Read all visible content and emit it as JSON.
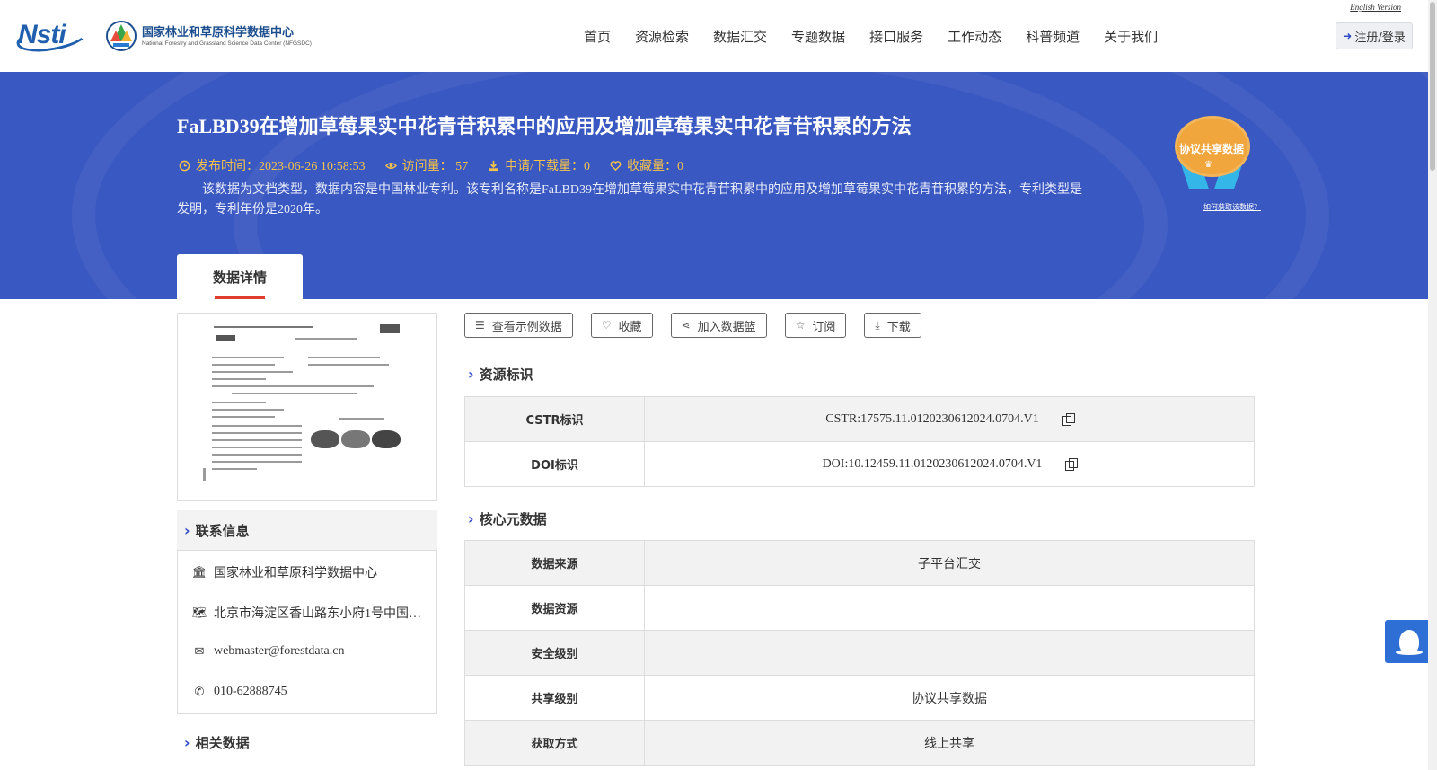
{
  "header": {
    "logo_nsti": "Nsti",
    "logo_center_cn": "国家林业和草原科学数据中心",
    "logo_center_en": "National Forestry and Grassland Science Data Center (NFGSDC)",
    "english_link": "English Version",
    "nav": [
      "首页",
      "资源检索",
      "数据汇交",
      "专题数据",
      "接口服务",
      "工作动态",
      "科普频道",
      "关于我们"
    ],
    "login_label": "注册/登录"
  },
  "banner": {
    "title": "FaLBD39在增加草莓果实中花青苷积累中的应用及增加草莓果实中花青苷积累的方法",
    "publish_time": "发布时间：2023-06-26 10:58:53",
    "visits": "访问量： 57",
    "downloads": "申请/下载量：0",
    "favorites": "收藏量：0",
    "description": "该数据为文档类型，数据内容是中国林业专利。该专利名称是FaLBD39在增加草莓果实中花青苷积累中的应用及增加草莓果实中花青苷积累的方法，专利类型是发明，专利年份是2020年。",
    "badge_label": "协议共享数据",
    "how_to_link": "如何获取该数据？",
    "tab_label": "数据详情"
  },
  "sidebar": {
    "contact_title": "联系信息",
    "contact": {
      "org": "国家林业和草原科学数据中心",
      "address": "北京市海淀区香山路东小府1号中国…",
      "email": "webmaster@forestdata.cn",
      "phone": "010-62888745"
    },
    "related_title": "相关数据"
  },
  "actions": [
    "查看示例数据",
    "收藏",
    "加入数据篮",
    "订阅",
    "下载"
  ],
  "identifier": {
    "title": "资源标识",
    "rows": [
      {
        "key": "CSTR标识",
        "value": "CSTR:17575.11.0120230612024.0704.V1"
      },
      {
        "key": "DOI标识",
        "value": "DOI:10.12459.11.0120230612024.0704.V1"
      }
    ]
  },
  "core_meta": {
    "title": "核心元数据",
    "rows": [
      {
        "key": "数据来源",
        "value": "子平台汇交"
      },
      {
        "key": "数据资源",
        "value": ""
      },
      {
        "key": "安全级别",
        "value": ""
      },
      {
        "key": "共享级别",
        "value": "协议共享数据"
      },
      {
        "key": "获取方式",
        "value": "线上共享"
      }
    ]
  },
  "colors": {
    "banner_bg": "#3a58c1",
    "accent_yellow": "#f5c24a",
    "tab_underline": "#e23c2c",
    "chevron": "#2e49c7"
  }
}
